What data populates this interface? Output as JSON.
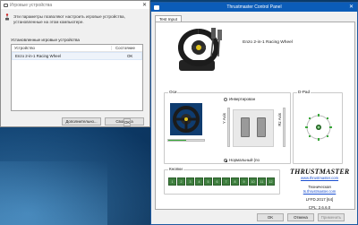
{
  "game_controllers": {
    "title": "Игровые устройства",
    "description": "Эти параметры позволяют настроить игровые устройства, установленные на этом компьютере.",
    "section": "Установленные игровые устройства",
    "columns": [
      "Устройство",
      "Состояние"
    ],
    "rows": [
      {
        "device": "Enzo 2-in-1 Racing Wheel",
        "status": "OK"
      }
    ],
    "advanced_label": "Дополнительно...",
    "properties_label": "Свойства",
    "ok_label": "OK"
  },
  "control_panel": {
    "title": "Thrustmaster Control Panel",
    "tab": "Test Input",
    "device_name": "Enzo 2-in-1 Racing Wheel",
    "axes_label": "Оси",
    "invert_label": "Инвертирован",
    "normal_label": "Нормальный (по",
    "y_axis_label": "Y Axis",
    "rz_axis_label": "Rz Axis",
    "dpad_label": "D-Pad",
    "buttons_label": "Кнопки",
    "button_numbers": [
      "1",
      "2",
      "3",
      "4",
      "5",
      "6",
      "7",
      "8",
      "9",
      "10",
      "11",
      "12"
    ],
    "logo": "THRUSTMASTER",
    "website": "www.thrustmaster.com",
    "support_label": "Техническая",
    "support_link": "ts.thrustmaster.com",
    "version": "LFFD.2017 [64]",
    "cpl_version": "CPL: 2.6.6.0",
    "ok_label": "OK",
    "cancel_label": "Отмена",
    "apply_label": "Применить",
    "steering_level": 0.5,
    "y_axis_level": 0.0,
    "rz_axis_level": 0.0
  },
  "colors": {
    "titlebar_active": "#0b5cb8",
    "axis_fill": "#3aa83a",
    "button_idle": "#3f7f3f"
  }
}
